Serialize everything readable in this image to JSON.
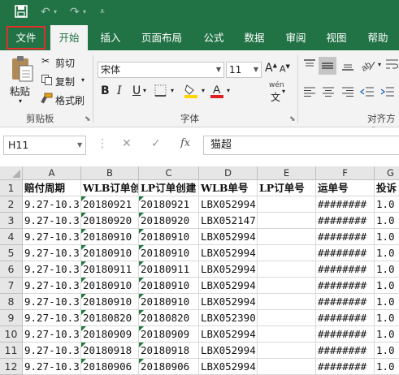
{
  "tabs": [
    "文件",
    "开始",
    "插入",
    "页面布局",
    "公式",
    "数据",
    "审阅",
    "视图",
    "帮助"
  ],
  "ribbon": {
    "paste": "粘贴",
    "cut": "剪切",
    "copy": "复制",
    "format_painter": "格式刷",
    "clipboard_group": "剪贴板",
    "font_name": "宋体",
    "font_size": "11",
    "font_group": "字体",
    "align_group": "对齐方式",
    "bold": "B",
    "italic": "I",
    "underline": "U",
    "wen": "wén",
    "grow_font": "A",
    "shrink_font": "A"
  },
  "formula_bar": {
    "name_box": "H11",
    "fx": "fx",
    "value": "猫超"
  },
  "columns": [
    "A",
    "B",
    "C",
    "D",
    "E",
    "F",
    "G"
  ],
  "rows": [
    [
      "赔付周期",
      "WLB订单创建",
      "LP订单创建",
      "WLB单号",
      "LP订单号",
      "运单号",
      "投诉"
    ],
    [
      "9.27-10.3",
      "20180921",
      "20180921",
      "LBX052994",
      "",
      "########",
      "1.0"
    ],
    [
      "9.27-10.3",
      "20180920",
      "20180920",
      "LBX052147",
      "",
      "########",
      "1.0"
    ],
    [
      "9.27-10.3",
      "20180910",
      "20180910",
      "LBX052994",
      "",
      "########",
      "1.0"
    ],
    [
      "9.27-10.3",
      "20180910",
      "20180910",
      "LBX052994",
      "",
      "########",
      "1.0"
    ],
    [
      "9.27-10.3",
      "20180911",
      "20180911",
      "LBX052994",
      "",
      "########",
      "1.0"
    ],
    [
      "9.27-10.3",
      "20180910",
      "20180910",
      "LBX052994",
      "",
      "########",
      "1.0"
    ],
    [
      "9.27-10.3",
      "20180910",
      "20180910",
      "LBX052994",
      "",
      "########",
      "1.0"
    ],
    [
      "9.27-10.3",
      "20180820",
      "20180820",
      "LBX052390",
      "",
      "########",
      "1.0"
    ],
    [
      "9.27-10.3",
      "20180909",
      "20180909",
      "LBX052994",
      "",
      "########",
      "1.0"
    ],
    [
      "9.27-10.3",
      "20180918",
      "20180918",
      "LBX052994",
      "",
      "########",
      "1.0"
    ],
    [
      "9.27-10.3",
      "20180906",
      "20180906",
      "LBX052994",
      "",
      "########",
      "1.0"
    ]
  ],
  "colors": {
    "excel_green": "#217346",
    "highlight_red": "#e0302a",
    "font_red": "#e02020",
    "fill_yellow": "#ffd500"
  }
}
